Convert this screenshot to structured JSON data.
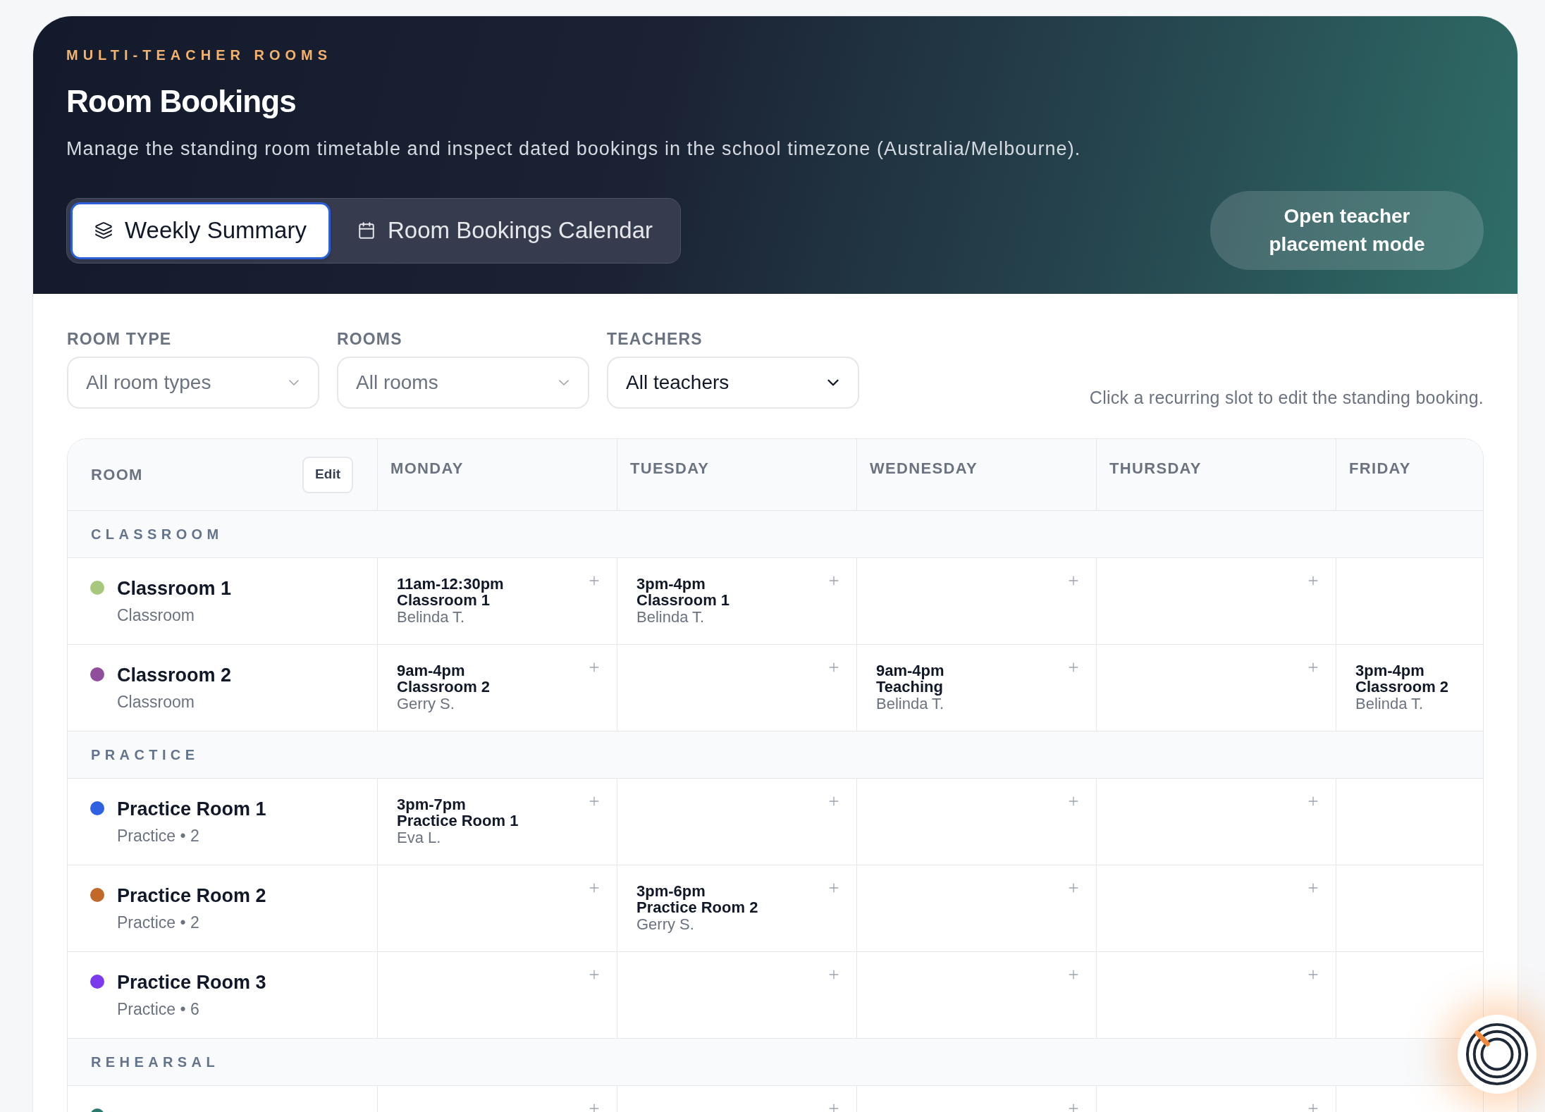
{
  "header": {
    "eyebrow": "MULTI-TEACHER ROOMS",
    "title": "Room Bookings",
    "description": "Manage the standing room timetable and inspect dated bookings in the school timezone (Australia/Melbourne).",
    "tabs": [
      {
        "label": "Weekly Summary",
        "selected": true
      },
      {
        "label": "Room Bookings Calendar",
        "selected": false
      }
    ],
    "action_button": "Open teacher placement mode"
  },
  "filters": [
    {
      "label": "ROOM TYPE",
      "placeholder": "All room types"
    },
    {
      "label": "ROOMS",
      "placeholder": "All rooms"
    },
    {
      "label": "TEACHERS",
      "value": "All teachers"
    }
  ],
  "hint": "Click a recurring slot to edit the standing booking.",
  "table": {
    "room_column": "ROOM",
    "edit_button": "Edit",
    "days": [
      "MONDAY",
      "TUESDAY",
      "WEDNESDAY",
      "THURSDAY",
      "FRIDAY"
    ],
    "groups": [
      {
        "name": "CLASSROOM",
        "rooms": [
          {
            "name": "Classroom 1",
            "detail": "Classroom",
            "color": "#a6c77c",
            "slots": [
              {
                "time": "11am-12:30pm",
                "title": "Classroom 1",
                "teacher": "Belinda T.",
                "add_button": true
              },
              {
                "time": "3pm-4pm",
                "title": "Classroom 1",
                "teacher": "Belinda T.",
                "add_button": true
              },
              {
                "add_button": true
              },
              {
                "add_button": true
              }
            ]
          },
          {
            "name": "Classroom 2",
            "detail": "Classroom",
            "color": "#8f4f9c",
            "slots": [
              {
                "time": "9am-4pm",
                "title": "Classroom 2",
                "teacher": "Gerry S.",
                "add_button": true
              },
              {
                "add_button": true
              },
              {
                "time": "9am-4pm",
                "title": "Teaching",
                "teacher": "Belinda T.",
                "add_button": true
              },
              {
                "add_button": true
              },
              {
                "time": "3pm-4pm",
                "title": "Classroom 2",
                "teacher": "Belinda T."
              }
            ]
          }
        ]
      },
      {
        "name": "PRACTICE",
        "rooms": [
          {
            "name": "Practice Room 1",
            "detail": "Practice • 2",
            "color": "#2f62e3",
            "slots": [
              {
                "time": "3pm-7pm",
                "title": "Practice Room 1",
                "teacher": "Eva L.",
                "add_button": true
              },
              {
                "add_button": true
              },
              {
                "add_button": true
              },
              {
                "add_button": true
              }
            ]
          },
          {
            "name": "Practice Room 2",
            "detail": "Practice • 2",
            "color": "#c2692a",
            "slots": [
              {
                "add_button": true
              },
              {
                "time": "3pm-6pm",
                "title": "Practice Room 2",
                "teacher": "Gerry S.",
                "add_button": true
              },
              {
                "add_button": true
              },
              {
                "add_button": true
              }
            ]
          },
          {
            "name": "Practice Room 3",
            "detail": "Practice • 6",
            "color": "#7c3aed",
            "slots": [
              {
                "add_button": true
              },
              {
                "add_button": true
              },
              {
                "add_button": true
              },
              {
                "add_button": true
              }
            ]
          }
        ]
      },
      {
        "name": "REHEARSAL",
        "rooms": [
          {
            "color": "#2a7a6e",
            "slots": [
              {
                "add_button": true
              },
              {
                "add_button": true
              },
              {
                "add_button": true
              },
              {
                "add_button": true
              }
            ]
          }
        ]
      }
    ]
  }
}
